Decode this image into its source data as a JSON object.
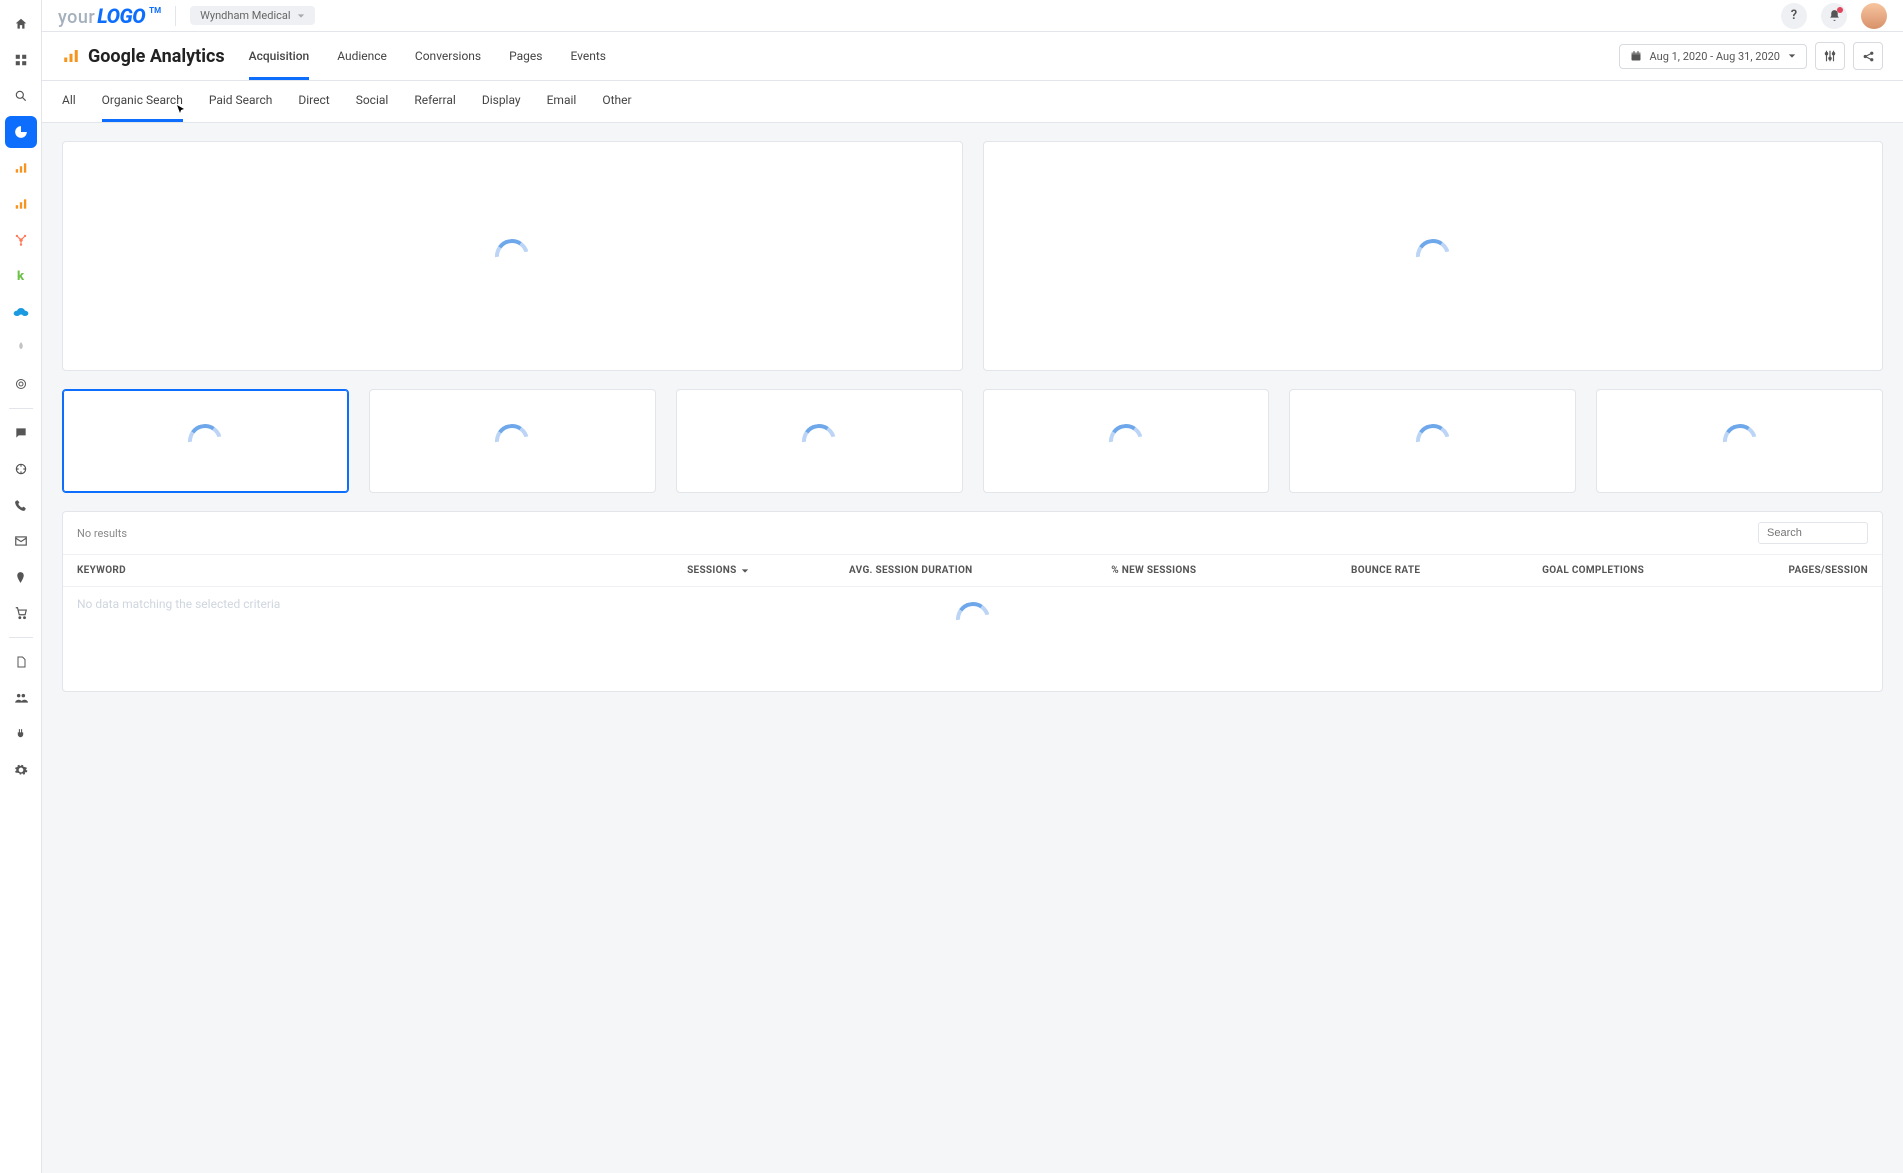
{
  "logo": {
    "part1": "your",
    "part2": "LOGO",
    "tm": "TM"
  },
  "client": {
    "name": "Wyndham Medical"
  },
  "page": {
    "title": "Google Analytics"
  },
  "date_range": {
    "label": "Aug 1, 2020 - Aug 31, 2020"
  },
  "primary_tabs": [
    {
      "label": "Acquisition",
      "active": true
    },
    {
      "label": "Audience",
      "active": false
    },
    {
      "label": "Conversions",
      "active": false
    },
    {
      "label": "Pages",
      "active": false
    },
    {
      "label": "Events",
      "active": false
    }
  ],
  "sub_tabs": [
    {
      "label": "All",
      "active": false
    },
    {
      "label": "Organic Search",
      "active": true
    },
    {
      "label": "Paid Search",
      "active": false
    },
    {
      "label": "Direct",
      "active": false
    },
    {
      "label": "Social",
      "active": false
    },
    {
      "label": "Referral",
      "active": false
    },
    {
      "label": "Display",
      "active": false
    },
    {
      "label": "Email",
      "active": false
    },
    {
      "label": "Other",
      "active": false
    }
  ],
  "table": {
    "no_results_label": "No results",
    "search_placeholder": "Search",
    "columns": [
      "KEYWORD",
      "SESSIONS",
      "AVG. SESSION DURATION",
      "% NEW SESSIONS",
      "BOUNCE RATE",
      "GOAL COMPLETIONS",
      "PAGES/SESSION"
    ],
    "empty_message": "No data matching the selected criteria"
  },
  "sidebar_icons": [
    "home-icon",
    "apps-icon",
    "search-icon",
    "pie-chart-icon",
    "analytics-icon-1",
    "analytics-icon-2",
    "hubspot-icon",
    "k-icon",
    "salesforce-icon",
    "plant-icon",
    "target-icon",
    "divider",
    "chat-icon",
    "goal-icon",
    "phone-icon",
    "mail-icon",
    "map-pin-icon",
    "cart-icon",
    "divider",
    "file-icon",
    "users-icon",
    "plug-icon",
    "gear-icon"
  ],
  "top_icons": {
    "help": "?",
    "notifications": "bell-icon"
  }
}
